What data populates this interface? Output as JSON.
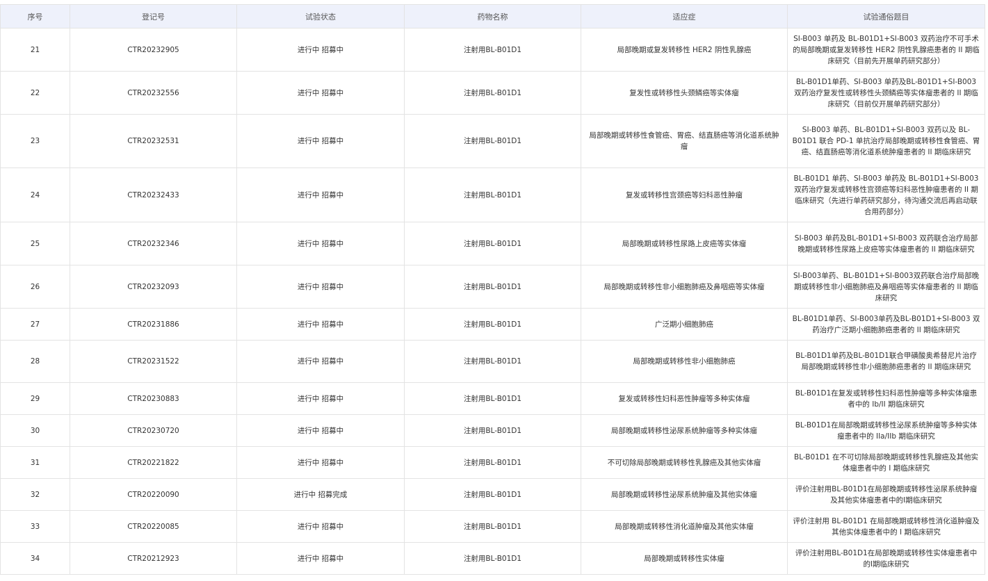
{
  "table": {
    "headers": [
      "序号",
      "登记号",
      "试验状态",
      "药物名称",
      "适应症",
      "试验通俗题目"
    ],
    "rows": [
      {
        "no": "21",
        "reg": "CTR20232905",
        "status": "进行中 招募中",
        "drug": "注射用BL-B01D1",
        "indication": "局部晚期或复发转移性 HER2 阴性乳腺癌",
        "title": "SI-B003 单药及 BL-B01D1+SI-B003 双药治疗不可手术的局部晚期或复发转移性 HER2 阴性乳腺癌患者的 II 期临床研究（目前先开展单药研究部分）"
      },
      {
        "no": "22",
        "reg": "CTR20232556",
        "status": "进行中 招募中",
        "drug": "注射用BL-B01D1",
        "indication": "复发性或转移性头颈鳞癌等实体瘤",
        "title": "BL-B01D1单药、SI-B003 单药及BL-B01D1+SI-B003 双药治疗复发性或转移性头颈鳞癌等实体瘤患者的 II 期临床研究（目前仅开展单药研究部分）"
      },
      {
        "no": "23",
        "reg": "CTR20232531",
        "status": "进行中 招募中",
        "drug": "注射用BL-B01D1",
        "indication": "局部晚期或转移性食管癌、胃癌、结直肠癌等消化道系统肿瘤",
        "title": "SI-B003 单药、BL-B01D1+SI-B003 双药以及 BL-B01D1 联合 PD-1 单抗治疗局部晚期或转移性食管癌、胃癌、结直肠癌等消化道系统肿瘤患者的 II 期临床研究"
      },
      {
        "no": "24",
        "reg": "CTR20232433",
        "status": "进行中 招募中",
        "drug": "注射用BL-B01D1",
        "indication": "复发或转移性宫颈癌等妇科恶性肿瘤",
        "title": "BL-B01D1 单药、SI-B003 单药及 BL-B01D1+SI-B003 双药治疗复发或转移性宫颈癌等妇科恶性肿瘤患者的 II 期临床研究（先进行单药研究部分，待沟通交流后再启动联合用药部分）"
      },
      {
        "no": "25",
        "reg": "CTR20232346",
        "status": "进行中 招募中",
        "drug": "注射用BL-B01D1",
        "indication": "局部晚期或转移性尿路上皮癌等实体瘤",
        "title": "SI-B003 单药及BL-B01D1+SI-B003 双药联合治疗局部晚期或转移性尿路上皮癌等实体瘤患者的 II 期临床研究"
      },
      {
        "no": "26",
        "reg": "CTR20232093",
        "status": "进行中 招募中",
        "drug": "注射用BL-B01D1",
        "indication": "局部晚期或转移性非小细胞肺癌及鼻咽癌等实体瘤",
        "title": "SI-B003单药、BL-B01D1+SI-B003双药联合治疗局部晚期或转移性非小细胞肺癌及鼻咽癌等实体瘤患者的 II 期临床研究"
      },
      {
        "no": "27",
        "reg": "CTR20231886",
        "status": "进行中 招募中",
        "drug": "注射用BL-B01D1",
        "indication": "广泛期小细胞肺癌",
        "title": "BL-B01D1单药、SI-B003单药及BL-B01D1+SI-B003 双药治疗广泛期小细胞肺癌患者的 II 期临床研究"
      },
      {
        "no": "28",
        "reg": "CTR20231522",
        "status": "进行中 招募中",
        "drug": "注射用BL-B01D1",
        "indication": "局部晚期或转移性非小细胞肺癌",
        "title": "BL-B01D1单药及BL-B01D1联合甲磺酸奥希替尼片治疗局部晚期或转移性非小细胞肺癌患者的 II 期临床研究"
      },
      {
        "no": "29",
        "reg": "CTR20230883",
        "status": "进行中 招募中",
        "drug": "注射用BL-B01D1",
        "indication": "复发或转移性妇科恶性肿瘤等多种实体瘤",
        "title": "BL-B01D1在复发或转移性妇科恶性肿瘤等多种实体瘤患者中的 Ib/II 期临床研究"
      },
      {
        "no": "30",
        "reg": "CTR20230720",
        "status": "进行中 招募中",
        "drug": "注射用BL-B01D1",
        "indication": "局部晚期或转移性泌尿系统肿瘤等多种实体瘤",
        "title": "BL-B01D1在局部晚期或转移性泌尿系统肿瘤等多种实体瘤患者中的 IIa/IIb 期临床研究"
      },
      {
        "no": "31",
        "reg": "CTR20221822",
        "status": "进行中 招募中",
        "drug": "注射用BL-B01D1",
        "indication": "不可切除局部晚期或转移性乳腺癌及其他实体瘤",
        "title": "BL-B01D1 在不可切除局部晚期或转移性乳腺癌及其他实体瘤患者中的 I 期临床研究"
      },
      {
        "no": "32",
        "reg": "CTR20220090",
        "status": "进行中 招募完成",
        "drug": "注射用BL-B01D1",
        "indication": "局部晚期或转移性泌尿系统肿瘤及其他实体瘤",
        "title": "评价注射用BL-B01D1在局部晚期或转移性泌尿系统肿瘤及其他实体瘤患者中的I期临床研究"
      },
      {
        "no": "33",
        "reg": "CTR20220085",
        "status": "进行中 招募中",
        "drug": "注射用BL-B01D1",
        "indication": "局部晚期或转移性消化道肿瘤及其他实体瘤",
        "title": "评价注射用 BL-B01D1 在局部晚期或转移性消化道肿瘤及其他实体瘤患者中的 I 期临床研究"
      },
      {
        "no": "34",
        "reg": "CTR20212923",
        "status": "进行中 招募中",
        "drug": "注射用BL-B01D1",
        "indication": "局部晚期或转移性实体瘤",
        "title": "评价注射用BL-B01D1在局部晚期或转移性实体瘤患者中的I期临床研究"
      }
    ]
  }
}
